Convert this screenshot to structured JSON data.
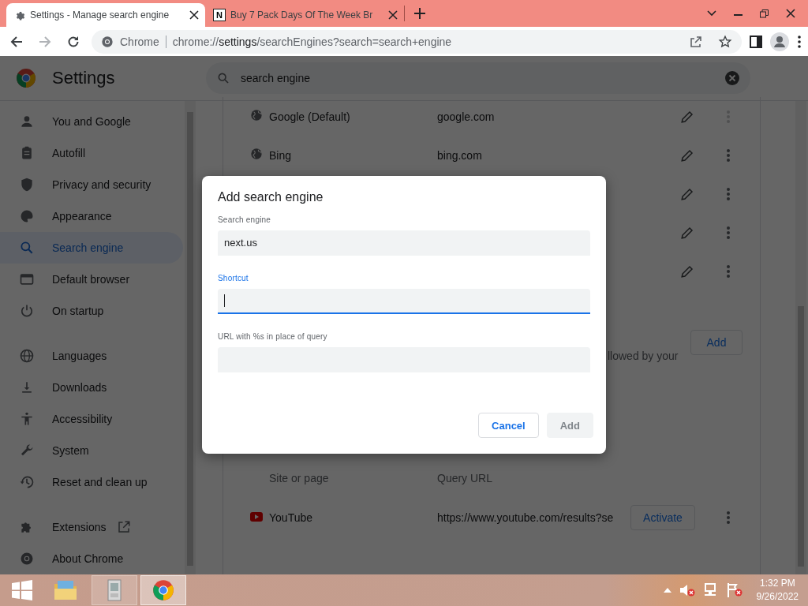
{
  "tabs": [
    {
      "title": "Settings - Manage search engine",
      "selected": true
    },
    {
      "title": "Buy 7 Pack Days Of The Week Br",
      "favicon_text": "N",
      "selected": false
    }
  ],
  "toolbar": {
    "site_chip": "Chrome",
    "url_scheme": "chrome://",
    "url_host": "settings",
    "url_path": "/searchEngines?search=search+engine"
  },
  "header": {
    "title": "Settings",
    "search": {
      "value": "search engine"
    }
  },
  "sidebar": {
    "groups": [
      [
        {
          "label": "You and Google",
          "selected": false
        },
        {
          "label": "Autofill",
          "selected": false
        },
        {
          "label": "Privacy and security",
          "selected": false
        },
        {
          "label": "Appearance",
          "selected": false
        },
        {
          "label": "Search engine",
          "selected": true
        },
        {
          "label": "Default browser",
          "selected": false
        },
        {
          "label": "On startup",
          "selected": false
        }
      ],
      [
        {
          "label": "Languages",
          "selected": false
        },
        {
          "label": "Downloads",
          "selected": false
        },
        {
          "label": "Accessibility",
          "selected": false
        },
        {
          "label": "System",
          "selected": false
        },
        {
          "label": "Reset and clean up",
          "selected": false
        }
      ],
      [
        {
          "label": "Extensions",
          "selected": false,
          "external": true
        },
        {
          "label": "About Chrome",
          "selected": false
        }
      ]
    ]
  },
  "engines": [
    {
      "name": "Google (Default)",
      "shortcut": "google.com",
      "more_disabled": true
    },
    {
      "name": "Bing",
      "shortcut": "bing.com",
      "more_disabled": false
    },
    {
      "more_disabled": false
    },
    {
      "more_disabled": false
    },
    {
      "more_disabled": false
    }
  ],
  "site_search": {
    "description_fragment": "llowed by your",
    "button": "Add"
  },
  "inactive": {
    "columns": [
      "Site or page",
      "Query URL"
    ],
    "rows": [
      {
        "name": "YouTube",
        "url": "https://www.youtube.com/results?se",
        "button": "Activate"
      }
    ]
  },
  "dialog": {
    "title": "Add search engine",
    "fields": [
      {
        "label": "Search engine",
        "value": "next.us",
        "focused": false
      },
      {
        "label": "Shortcut",
        "focused": true
      },
      {
        "label": "URL with %s in place of query",
        "focused": false
      }
    ],
    "buttons": [
      {
        "label": "Cancel",
        "disabled": false
      },
      {
        "label": "Add",
        "disabled": true
      }
    ]
  },
  "taskbar": {
    "apps": [
      {
        "running": false,
        "selected": false
      },
      {
        "running": true,
        "selected": false
      },
      {
        "running": true,
        "selected": true
      }
    ],
    "time": "1:32 PM",
    "date": "9/26/2022"
  }
}
